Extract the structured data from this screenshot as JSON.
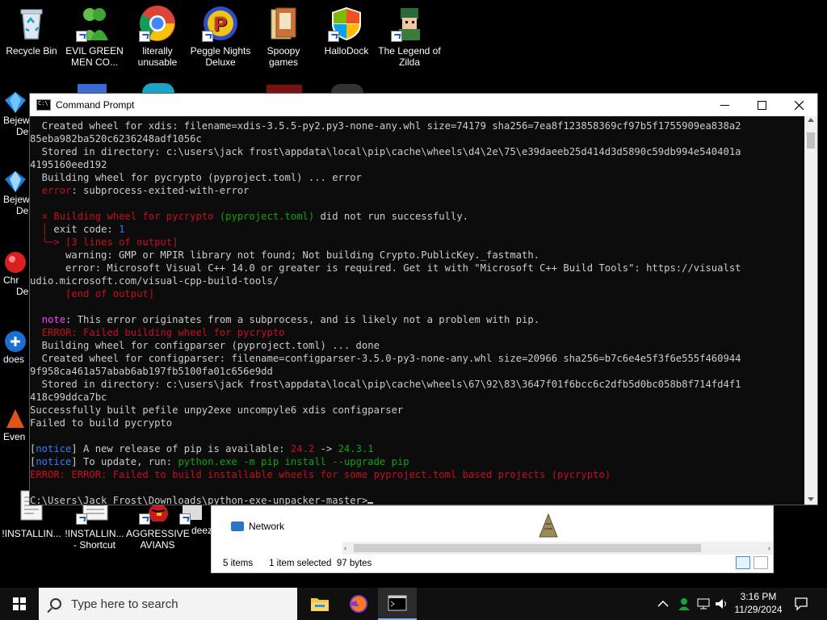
{
  "desktop": {
    "icons": [
      {
        "label": "Recycle Bin",
        "icon": "recycle-bin-icon"
      },
      {
        "label": "EVIL GREEN MEN CO...",
        "icon": "green-men-icon"
      },
      {
        "label": "literally unusable",
        "icon": "chrome-icon"
      },
      {
        "label": "Peggle Nights Deluxe",
        "icon": "peggle-icon"
      },
      {
        "label": "Spoopy games",
        "icon": "folder-icon"
      },
      {
        "label": "HalloDock",
        "icon": "windows-shield-icon"
      },
      {
        "label": "The Legend of Zilda",
        "icon": "zilda-icon"
      }
    ],
    "left_icons": [
      "Bejew",
      "Bejew",
      "Chr",
      "does",
      "Even"
    ],
    "left_icons_2nd": [
      "De",
      "Del",
      "Del",
      "",
      ""
    ],
    "bottom_icons": [
      {
        "label": "!INSTALLIN..."
      },
      {
        "label": "!INSTALLIN... - Shortcut"
      },
      {
        "label": "AGGRESSIVE AVIANS"
      },
      {
        "label": "deez"
      }
    ]
  },
  "cmd": {
    "title": "Command Prompt",
    "lines": [
      [
        {
          "t": "  Created wheel for xdis: filename=xdis-3.5.5-py2.py3-none-any.whl size=74179 sha256=7ea8f123858369cf97b5f1755909ea838a2"
        }
      ],
      [
        {
          "t": "85eba982ba520c6236248adf1056c"
        }
      ],
      [
        {
          "t": "  Stored in directory: c:\\users\\jack frost\\appdata\\local\\pip\\cache\\wheels\\d4\\2e\\75\\e39daeeb25d414d3d5890c59db994e540401a"
        }
      ],
      [
        {
          "t": "4195160eed192"
        }
      ],
      [
        {
          "t": "  Building wheel for pycrypto (pyproject.toml) ... error"
        }
      ],
      [
        {
          "t": "  "
        },
        {
          "t": "error",
          "c": "r"
        },
        {
          "t": ": subprocess-exited-with-error"
        }
      ],
      [
        {
          "t": ""
        }
      ],
      [
        {
          "t": "  "
        },
        {
          "t": "× Building wheel for pycrypto ",
          "c": "r"
        },
        {
          "t": "(pyproject.toml)",
          "c": "g"
        },
        {
          "t": " did not run successfully."
        }
      ],
      [
        {
          "t": "  "
        },
        {
          "t": "│",
          "c": "r"
        },
        {
          "t": " exit code: "
        },
        {
          "t": "1",
          "c": "b"
        }
      ],
      [
        {
          "t": "  "
        },
        {
          "t": "╰─> [3 lines of output]",
          "c": "r"
        }
      ],
      [
        {
          "t": "      warning: GMP or MPIR library not found; Not building Crypto.PublicKey._fastmath."
        }
      ],
      [
        {
          "t": "      error: Microsoft Visual C++ 14.0 or greater is required. Get it with \"Microsoft C++ Build Tools\": https://visualst"
        }
      ],
      [
        {
          "t": "udio.microsoft.com/visual-cpp-build-tools/"
        }
      ],
      [
        {
          "t": "      "
        },
        {
          "t": "[end of output]",
          "c": "r"
        }
      ],
      [
        {
          "t": ""
        }
      ],
      [
        {
          "t": "  "
        },
        {
          "t": "note",
          "c": "m"
        },
        {
          "t": ": This error originates from a subprocess, and is likely not a problem with pip."
        }
      ],
      [
        {
          "t": "  "
        },
        {
          "t": "ERROR: Failed building wheel for pycrypto",
          "c": "r"
        }
      ],
      [
        {
          "t": "  Building wheel for configparser (pyproject.toml) ... done"
        }
      ],
      [
        {
          "t": "  Created wheel for configparser: filename=configparser-3.5.0-py3-none-any.whl size=20966 sha256=b7c6e4e5f3f6e555f460944"
        }
      ],
      [
        {
          "t": "9f958ca461a57abab6ab197fb5100fa01c656e9dd"
        }
      ],
      [
        {
          "t": "  Stored in directory: c:\\users\\jack frost\\appdata\\local\\pip\\cache\\wheels\\67\\92\\83\\3647f01f6bcc6c2dfb5d0bc058b8f714fd4f1"
        }
      ],
      [
        {
          "t": "418c99ddca7bc"
        }
      ],
      [
        {
          "t": "Successfully built pefile unpy2exe uncompyle6 xdis configparser"
        }
      ],
      [
        {
          "t": "Failed to build pycrypto"
        }
      ],
      [
        {
          "t": ""
        }
      ],
      [
        {
          "t": "["
        },
        {
          "t": "notice",
          "c": "b"
        },
        {
          "t": "] A new release of pip is available: "
        },
        {
          "t": "24.2",
          "c": "r"
        },
        {
          "t": " -> "
        },
        {
          "t": "24.3.1",
          "c": "g"
        }
      ],
      [
        {
          "t": "["
        },
        {
          "t": "notice",
          "c": "b"
        },
        {
          "t": "] To update, run: "
        },
        {
          "t": "python.exe -m pip install --upgrade pip",
          "c": "g"
        }
      ],
      [
        {
          "t": "ERROR: ERROR: Failed to build installable wheels for some pyproject.toml based projects (pycrypto)",
          "c": "r"
        }
      ],
      [
        {
          "t": ""
        }
      ],
      [
        {
          "t": "C:\\Users\\Jack Frost\\Downloads\\python-exe-unpacker-master>"
        }
      ]
    ]
  },
  "explorer": {
    "nav_item": "Network",
    "status_items": "5 items",
    "status_selected": "1 item selected",
    "status_size": "97 bytes"
  },
  "taskbar": {
    "search_placeholder": "Type here to search",
    "time": "3:16 PM",
    "date": "11/29/2024"
  }
}
